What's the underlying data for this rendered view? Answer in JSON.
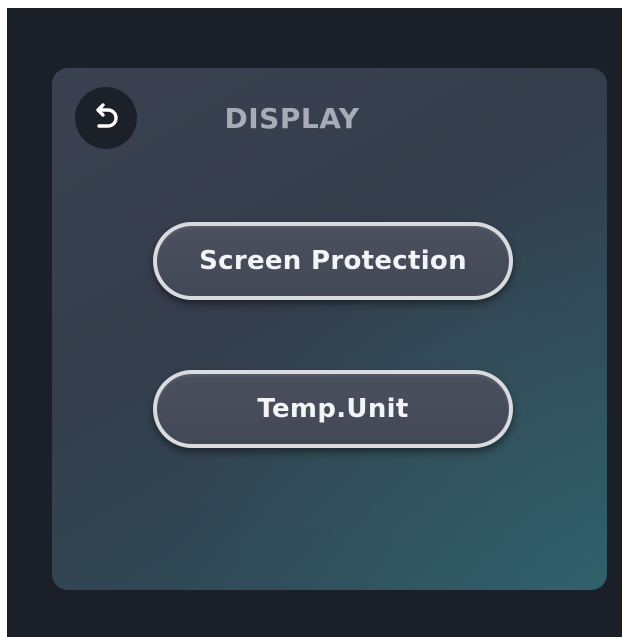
{
  "header": {
    "back_icon": "undo-arrow-icon",
    "title": "DISPLAY"
  },
  "menu": {
    "items": [
      {
        "label": "Screen Protection"
      },
      {
        "label": "Temp.Unit"
      }
    ]
  },
  "colors": {
    "background": "#1b1f28",
    "panel_top": "#3b4150",
    "panel_bottom": "#2a5560",
    "button_fill": "#454b59",
    "button_border": "#d9dbdf",
    "title_text": "#a7acb6",
    "button_text": "#f3f4f6"
  }
}
